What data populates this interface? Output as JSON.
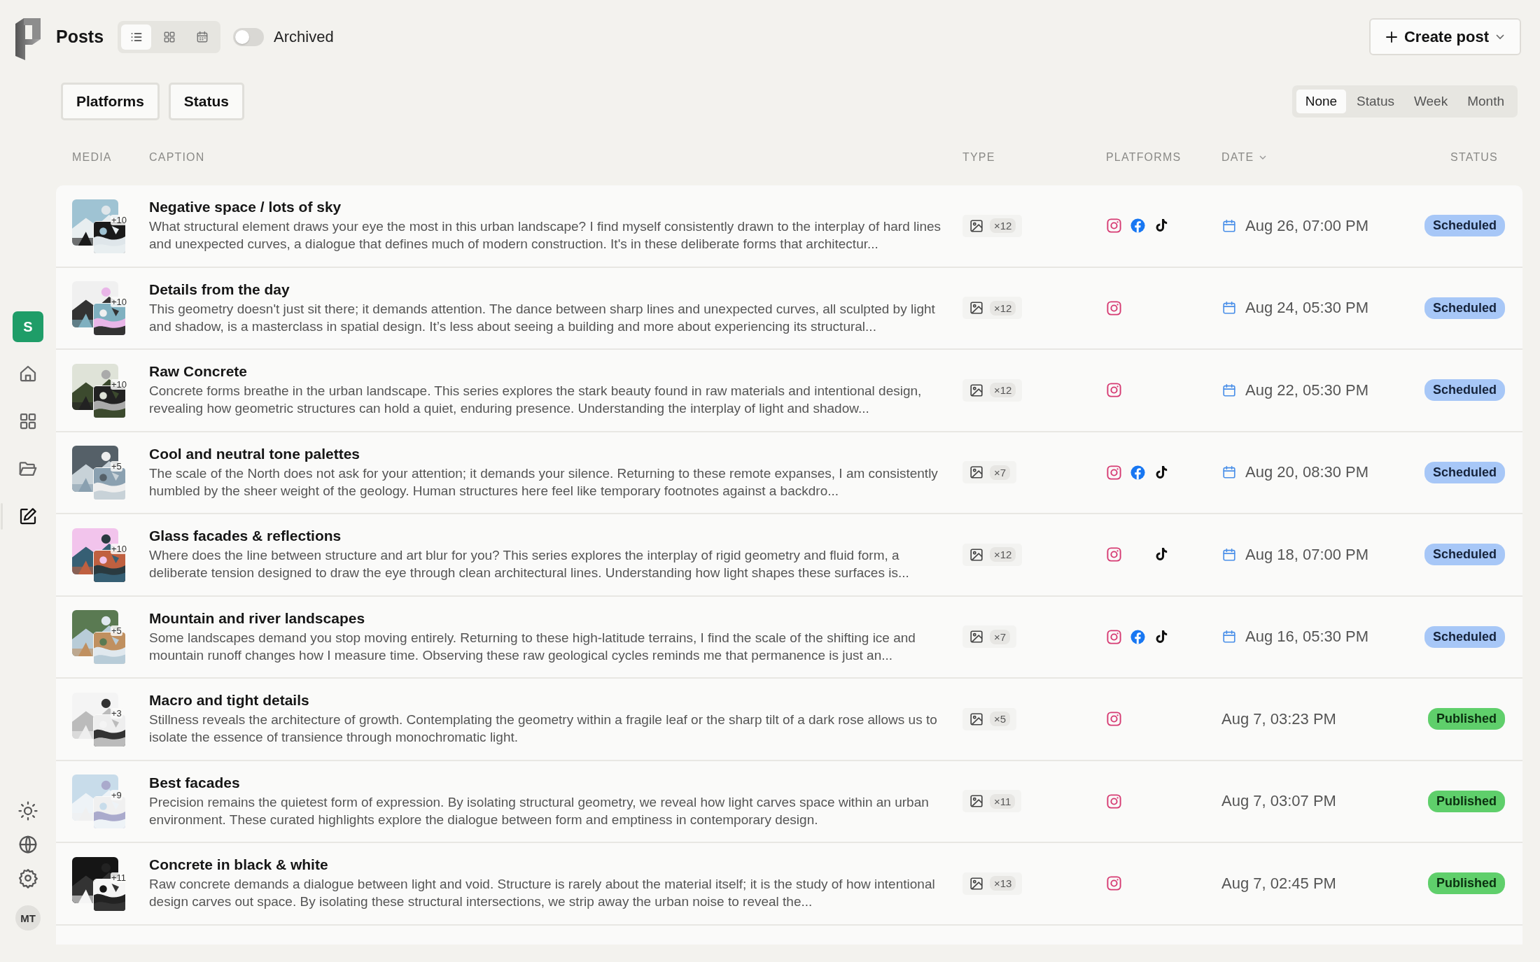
{
  "header": {
    "title": "Posts",
    "views": [
      {
        "kind": "list",
        "selected": true
      },
      {
        "kind": "grid",
        "selected": false
      },
      {
        "kind": "calendar",
        "selected": false
      }
    ],
    "archived": {
      "label": "Archived",
      "on": false
    },
    "create_button": {
      "label": "Create post"
    }
  },
  "sidebar": {
    "workspace": "S",
    "nav": [
      {
        "kind": "home",
        "selected": false
      },
      {
        "kind": "grid",
        "selected": false
      },
      {
        "kind": "folder",
        "selected": false
      },
      {
        "kind": "edit",
        "selected": true
      }
    ],
    "footer": [
      {
        "kind": "sun"
      },
      {
        "kind": "globe"
      },
      {
        "kind": "settings"
      }
    ],
    "avatar": "MT"
  },
  "filters": [
    "Platforms",
    "Status"
  ],
  "grouping": [
    {
      "label": "None",
      "selected": true
    },
    {
      "label": "Status",
      "selected": false
    },
    {
      "label": "Week",
      "selected": false
    },
    {
      "label": "Month",
      "selected": false
    }
  ],
  "table": {
    "columns": [
      {
        "label": "MEDIA",
        "dropdown": false
      },
      {
        "label": "CAPTION",
        "dropdown": false
      },
      {
        "label": "TYPE",
        "dropdown": false
      },
      {
        "label": "PLATFORMS",
        "dropdown": false
      },
      {
        "label": "DATE",
        "dropdown": true
      },
      {
        "label": "STATUS",
        "dropdown": false
      }
    ],
    "rows": [
      {
        "title": "Negative space / lots of sky",
        "caption": "What structural element draws your eye the most in this urban landscape? I find myself consistently drawn to the interplay of hard lines and unexpected curves, a dialogue that defines much of modern construction. It's in these deliberate forms that architectur...",
        "media_count": "+10",
        "type_count": "×12",
        "platforms": [
          {
            "kind": "instagram"
          },
          {
            "kind": "facebook"
          },
          {
            "kind": "tiktok"
          }
        ],
        "date": "Aug 26, 07:00 PM",
        "status": {
          "label": "Scheduled",
          "kind": "scheduled"
        }
      },
      {
        "title": "Details from the day",
        "caption": "This geometry doesn't just sit there; it demands attention. The dance between sharp lines and unexpected curves, all sculpted by light and shadow, is a masterclass in spatial design. It’s less about seeing a building and more about experiencing its structural...",
        "media_count": "+10",
        "type_count": "×12",
        "platforms": [
          {
            "kind": "instagram"
          }
        ],
        "date": "Aug 24, 05:30 PM",
        "status": {
          "label": "Scheduled",
          "kind": "scheduled"
        }
      },
      {
        "title": "Raw Concrete",
        "caption": "Concrete forms breathe in the urban landscape. This series explores the stark beauty found in raw materials and intentional design, revealing how geometric structures can hold a quiet, enduring presence. Understanding the interplay of light and shadow...",
        "media_count": "+10",
        "type_count": "×12",
        "platforms": [
          {
            "kind": "instagram"
          }
        ],
        "date": "Aug 22, 05:30 PM",
        "status": {
          "label": "Scheduled",
          "kind": "scheduled"
        }
      },
      {
        "title": "Cool and neutral tone palettes",
        "caption": "The scale of the North does not ask for your attention; it demands your silence. Returning to these remote expanses, I am consistently humbled by the sheer weight of the geology. Human structures here feel like temporary footnotes against a backdro...",
        "media_count": "+5",
        "type_count": "×7",
        "platforms": [
          {
            "kind": "instagram"
          },
          {
            "kind": "facebook"
          },
          {
            "kind": "tiktok"
          }
        ],
        "date": "Aug 20, 08:30 PM",
        "status": {
          "label": "Scheduled",
          "kind": "scheduled"
        }
      },
      {
        "title": "Glass facades & reflections",
        "caption": "Where does the line between structure and art blur for you? This series explores the interplay of rigid geometry and fluid form, a deliberate tension designed to draw the eye through clean architectural lines. Understanding how light shapes these surfaces is...",
        "media_count": "+10",
        "type_count": "×12",
        "platforms": [
          {
            "kind": "instagram"
          },
          {
            "kind": "tiktok"
          }
        ],
        "date": "Aug 18, 07:00 PM",
        "status": {
          "label": "Scheduled",
          "kind": "scheduled"
        }
      },
      {
        "title": "Mountain and river landscapes",
        "caption": "Some landscapes demand you stop moving entirely. Returning to these high-latitude terrains, I find the scale of the shifting ice and mountain runoff changes how I measure time. Observing these raw geological cycles reminds me that permanence is just an...",
        "media_count": "+5",
        "type_count": "×7",
        "platforms": [
          {
            "kind": "instagram"
          },
          {
            "kind": "facebook"
          },
          {
            "kind": "tiktok"
          }
        ],
        "date": "Aug 16, 05:30 PM",
        "status": {
          "label": "Scheduled",
          "kind": "scheduled"
        }
      },
      {
        "title": "Macro and tight details",
        "caption": "Stillness reveals the architecture of growth. Contemplating the geometry within a fragile leaf or the sharp tilt of a dark rose allows us to isolate the essence of transience through monochromatic light.",
        "media_count": "+3",
        "type_count": "×5",
        "platforms": [
          {
            "kind": "instagram"
          }
        ],
        "date": "Aug 7, 03:23 PM",
        "status": {
          "label": "Published",
          "kind": "published"
        }
      },
      {
        "title": "Best facades",
        "caption": "Precision remains the quietest form of expression. By isolating structural geometry, we reveal how light carves space within an urban environment. These curated highlights explore the dialogue between form and emptiness in contemporary design.",
        "media_count": "+9",
        "type_count": "×11",
        "platforms": [
          {
            "kind": "instagram"
          }
        ],
        "date": "Aug 7, 03:07 PM",
        "status": {
          "label": "Published",
          "kind": "published"
        }
      },
      {
        "title": "Concrete in black & white",
        "caption": "Raw concrete demands a dialogue between light and void. Structure is rarely about the material itself; it is the study of how intentional design carves out space. By isolating these structural intersections, we strip away the urban noise to reveal the...",
        "media_count": "+11",
        "type_count": "×13",
        "platforms": [
          {
            "kind": "instagram"
          }
        ],
        "date": "Aug 7, 02:45 PM",
        "status": {
          "label": "Published",
          "kind": "published"
        }
      }
    ]
  }
}
